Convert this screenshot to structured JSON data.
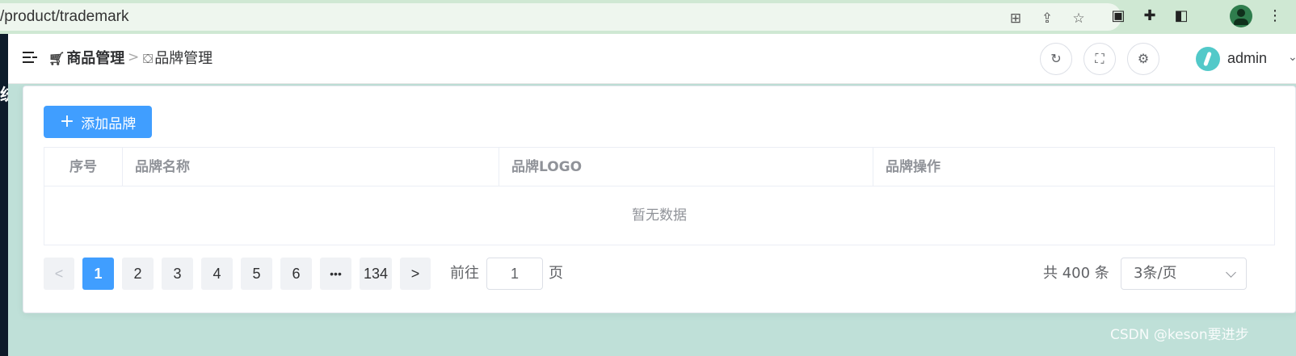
{
  "browser": {
    "url": "/product/trademark"
  },
  "sidebar": {
    "partial_glyph": "统"
  },
  "header": {
    "breadcrumb": [
      {
        "label": "商品管理",
        "icon": "cart-icon"
      },
      {
        "label": "品牌管理",
        "icon": "bag-icon"
      }
    ],
    "separator": ">",
    "user": {
      "name": "admin"
    }
  },
  "toolbar": {
    "add_label": "添加品牌"
  },
  "table": {
    "columns": [
      "序号",
      "品牌名称",
      "品牌LOGO",
      "品牌操作"
    ],
    "rows": [],
    "empty_text": "暂无数据"
  },
  "pagination": {
    "prev": "<",
    "next": ">",
    "pages": [
      "1",
      "2",
      "3",
      "4",
      "5",
      "6"
    ],
    "ellipsis": "•••",
    "last_page": "134",
    "current_page": "1",
    "goto_prefix": "前往",
    "goto_value": "1",
    "goto_suffix": "页",
    "total_text": "共 400 条",
    "page_size": "3条/页"
  },
  "watermark": "CSDN @keson要进步",
  "colors": {
    "primary": "#409eff",
    "sidebar": "#0d1b2a",
    "background": "#bfe0d8"
  }
}
